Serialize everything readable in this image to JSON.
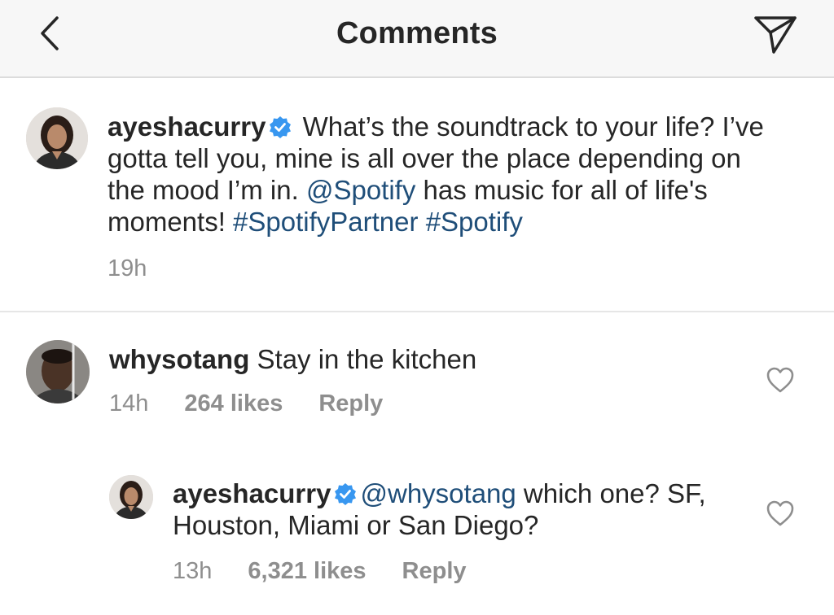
{
  "header": {
    "title": "Comments",
    "back_icon": "chevron-left-icon",
    "share_icon": "paper-plane-icon"
  },
  "caption": {
    "username": "ayeshacurry",
    "verified": true,
    "text_1": " What’s the soundtrack to your life? I’ve gotta tell you, mine is all over the place depending on the mood I’m in. ",
    "mention": "@Spotify",
    "text_2": " has music for all of life's moments! ",
    "hashtag_1": "#SpotifyPartner",
    "hashtag_2": "#Spotify",
    "time": "19h"
  },
  "comments": [
    {
      "username": "whysotang",
      "text": " Stay in the kitchen",
      "time": "14h",
      "likes": "264 likes",
      "reply_label": "Reply"
    }
  ],
  "replies": [
    {
      "username": "ayeshacurry",
      "verified": true,
      "mention": "@whysotang",
      "text": " which one? SF, Houston, Miami or San Diego?",
      "time": "13h",
      "likes": "6,321 likes",
      "reply_label": "Reply"
    }
  ],
  "colors": {
    "link": "#1f4e79",
    "verified_badge": "#3897f0",
    "muted_text": "#8e8e8e",
    "header_bg": "#f7f7f7"
  }
}
